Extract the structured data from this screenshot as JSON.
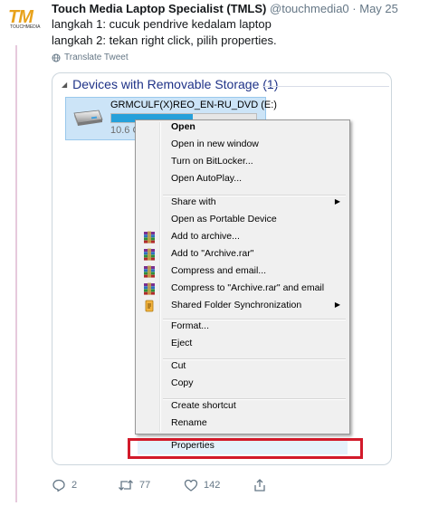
{
  "tweet": {
    "avatar_text": "TM",
    "avatar_subtext": "TOUCHMEDIA",
    "author_name": "Touch Media Laptop Specialist (TMLS)",
    "handle": "@touchmedia0",
    "separator": "·",
    "date": "May 25",
    "line1": "langkah 1: cucuk pendrive kedalam laptop",
    "line2": "langkah 2: tekan right click, pilih properties.",
    "translate_label": "Translate Tweet",
    "reply_count": "2",
    "retweet_count": "77",
    "like_count": "142"
  },
  "explorer": {
    "group_title": "Devices with Removable Storage (1)",
    "drive_name": "GRMCULF(X)REO_EN-RU_DVD (E:)",
    "drive_size": "10.6 G",
    "drive_fill": 0.56
  },
  "menu": {
    "items": [
      {
        "label": "Open",
        "bold": true,
        "icon": null,
        "submenu": false
      },
      {
        "label": "Open in new window",
        "bold": false,
        "icon": null,
        "submenu": false
      },
      {
        "label": "Turn on BitLocker...",
        "bold": false,
        "icon": null,
        "submenu": false
      },
      {
        "label": "Open AutoPlay...",
        "bold": false,
        "icon": null,
        "submenu": false
      },
      {
        "label": "Share with",
        "bold": false,
        "icon": null,
        "submenu": true
      },
      {
        "label": "Open as Portable Device",
        "bold": false,
        "icon": null,
        "submenu": false
      },
      {
        "label": "Add to archive...",
        "bold": false,
        "icon": "winrar-icon",
        "submenu": false
      },
      {
        "label": "Add to \"Archive.rar\"",
        "bold": false,
        "icon": "winrar-icon",
        "submenu": false
      },
      {
        "label": "Compress and email...",
        "bold": false,
        "icon": "winrar-icon",
        "submenu": false
      },
      {
        "label": "Compress to \"Archive.rar\" and email",
        "bold": false,
        "icon": "winrar-icon",
        "submenu": false
      },
      {
        "label": "Shared Folder Synchronization",
        "bold": false,
        "icon": "sync-icon",
        "submenu": true
      },
      {
        "label": "Format...",
        "bold": false,
        "icon": null,
        "submenu": false
      },
      {
        "label": "Eject",
        "bold": false,
        "icon": null,
        "submenu": false
      },
      {
        "label": "Cut",
        "bold": false,
        "icon": null,
        "submenu": false
      },
      {
        "label": "Copy",
        "bold": false,
        "icon": null,
        "submenu": false
      },
      {
        "label": "Create shortcut",
        "bold": false,
        "icon": null,
        "submenu": false
      },
      {
        "label": "Rename",
        "bold": false,
        "icon": null,
        "submenu": false
      },
      {
        "label": "Properties",
        "bold": false,
        "icon": null,
        "submenu": false,
        "highlighted": true
      }
    ]
  },
  "colors": {
    "highlight_box": "#d21a2a",
    "group_title": "#1e3287",
    "drive_selection": "#cce4f7",
    "avatar_brand": "#e8a21b"
  }
}
